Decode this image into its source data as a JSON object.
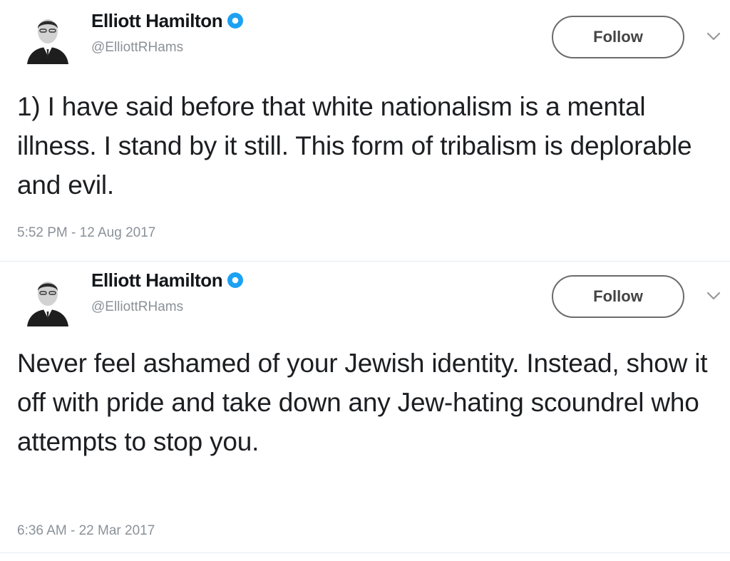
{
  "colors": {
    "verified_blue": "#1da1f2",
    "name_text": "#14171a",
    "muted_text": "#8a9198",
    "button_border": "#6b6b6b"
  },
  "icons": {
    "avatar": "user-avatar-icon",
    "verified": "verified-badge-icon",
    "caret": "chevron-down-icon"
  },
  "tweets": [
    {
      "display_name": "Elliott Hamilton",
      "handle": "@ElliottRHams",
      "follow_label": "Follow",
      "text": "1) I have said before that white nationalism is a mental illness. I stand by it still. This form of tribalism is deplorable and evil.",
      "timestamp": "5:52 PM - 12 Aug 2017"
    },
    {
      "display_name": "Elliott Hamilton",
      "handle": "@ElliottRHams",
      "follow_label": "Follow",
      "text": "Never feel ashamed of your Jewish identity. Instead, show it off with pride and take down any Jew-hating scoundrel who attempts to stop you.",
      "timestamp": "6:36 AM - 22 Mar 2017"
    }
  ]
}
